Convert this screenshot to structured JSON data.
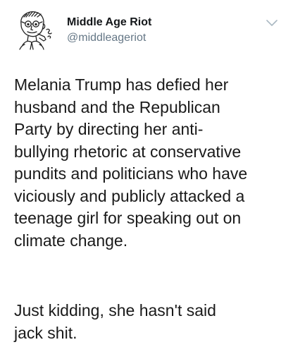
{
  "tweet": {
    "author": {
      "name": "Middle Age Riot",
      "handle": "@middleageriot",
      "avatar_icon": "cartoon-man-avatar-icon"
    },
    "menu_icon": "chevron-down-icon",
    "paragraphs": [
      {
        "lines": [
          "Melania Trump has defied her",
          "husband and the Republican",
          "Party by directing her anti-",
          "bullying rhetoric at conservative",
          "pundits and politicians who have",
          "viciously and publicly attacked a",
          "teenage girl for speaking out on",
          "climate change."
        ]
      },
      {
        "lines": [
          "Just kidding, she hasn't said",
          "jack shit."
        ]
      }
    ]
  },
  "colors": {
    "name": "#14171a",
    "handle": "#657786",
    "text": "#1a1a1a",
    "caret": "#aab8c2"
  }
}
